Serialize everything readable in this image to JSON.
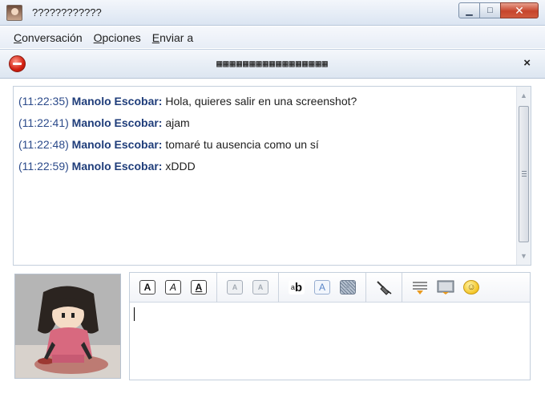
{
  "window": {
    "title": "????????????",
    "buttons": {
      "minimize": "▁",
      "maximize": "□",
      "close": "✕"
    }
  },
  "menu": [
    {
      "accel": "C",
      "rest": "onversación"
    },
    {
      "accel": "O",
      "rest": "pciones"
    },
    {
      "accel": "E",
      "rest": "nviar a"
    }
  ],
  "conversation": {
    "title": "▦▦▦▦▦▦▦▦▦▦▦▦▦▦▦▦▦",
    "close": "×",
    "messages": [
      {
        "time": "(11:22:35)",
        "nick": "Manolo Escobar:",
        "text": "Hola, quieres salir en una screenshot?"
      },
      {
        "time": "(11:22:41)",
        "nick": "Manolo Escobar:",
        "text": "ajam"
      },
      {
        "time": "(11:22:48)",
        "nick": "Manolo Escobar:",
        "text": "tomaré tu ausencia como un sí"
      },
      {
        "time": "(11:22:59)",
        "nick": "Manolo Escobar:",
        "text": "xDDD"
      }
    ]
  },
  "toolbar": {
    "bold": "A",
    "italic": "A",
    "underline": "A",
    "grow_font": "A",
    "shrink_font": "A",
    "font_face_b": "b",
    "font_face_a": "a",
    "fg_color": "A",
    "bg_color": "A",
    "clear_format": "clear-format-icon",
    "insert_link": "link-icon",
    "insert_image": "image-icon",
    "smiley": "☺"
  },
  "input": {
    "value": ""
  },
  "colors": {
    "nick": "#1f3d7a",
    "timestamp": "#2b4a8a",
    "close_button": "#c6452c"
  }
}
